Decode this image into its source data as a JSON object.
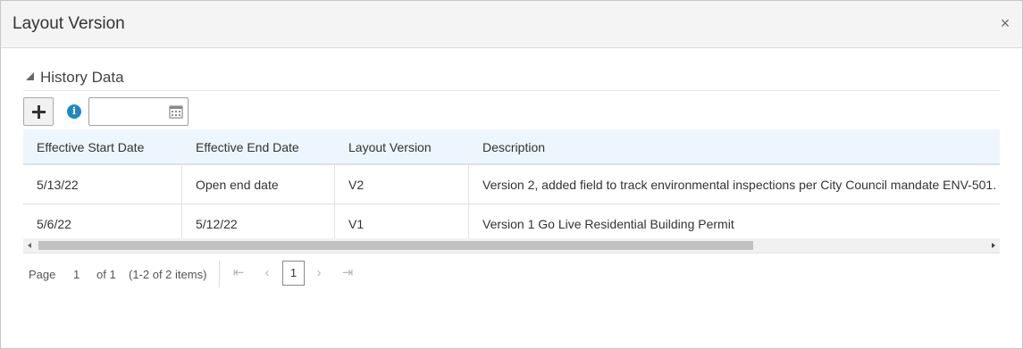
{
  "dialog": {
    "title": "Layout Version",
    "close_glyph": "×",
    "close_icon": "close-icon"
  },
  "section": {
    "title": "History Data",
    "collapse_icon": "triangle-collapse-icon"
  },
  "toolbar": {
    "add_icon": "plus-icon",
    "info_icon": "info-icon",
    "info_glyph": "i",
    "date_value": "",
    "date_placeholder": "",
    "calendar_icon": "calendar-icon"
  },
  "table": {
    "columns": [
      "Effective Start Date",
      "Effective End Date",
      "Layout Version",
      "Description"
    ],
    "rows": [
      [
        "5/13/22",
        "Open end date",
        "V2",
        "Version 2, added field to track environmental inspections per City Council mandate ENV-501."
      ],
      [
        "5/6/22",
        "5/12/22",
        "V1",
        "Version 1 Go Live Residential Building Permit"
      ]
    ],
    "header_bg": "#edf6fc"
  },
  "pager": {
    "page_label": "Page",
    "page_number": "1",
    "of_label": "of 1",
    "items_label": "(1-2 of 2 items)",
    "current_page": "1",
    "first_glyph": "⇤",
    "prev_glyph": "‹",
    "next_glyph": "›",
    "last_glyph": "⇥"
  },
  "colors": {
    "info_blue": "#1e8ac4",
    "header_bg": "#f4f4f4"
  }
}
